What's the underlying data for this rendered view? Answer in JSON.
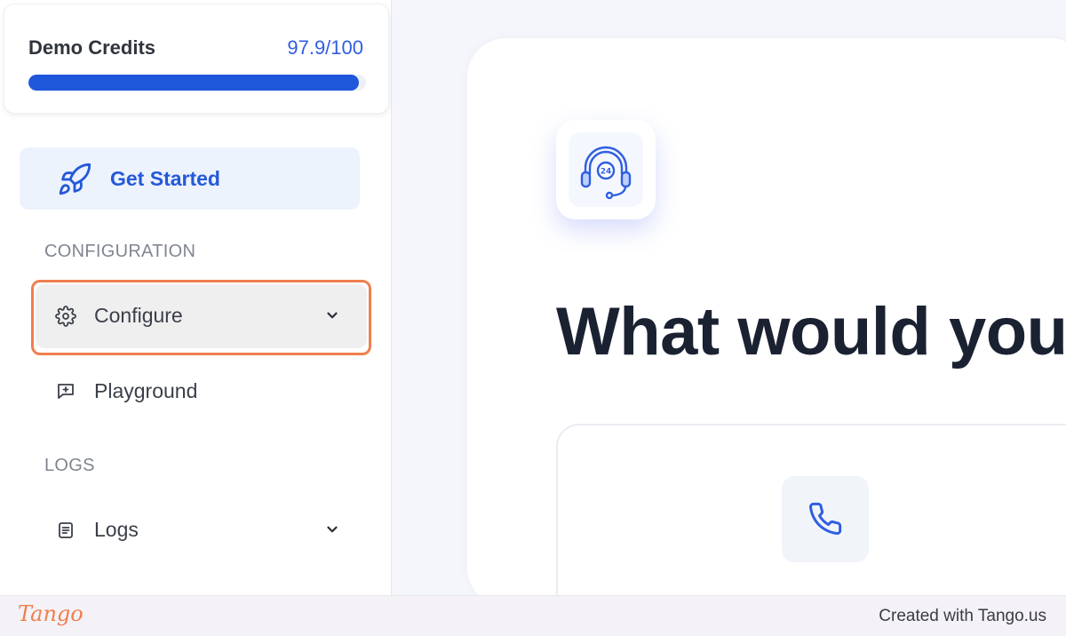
{
  "credits": {
    "label": "Demo Credits",
    "value": "97.9/100",
    "progress_fraction": 0.979,
    "bar_color": "#1f57db"
  },
  "nav": {
    "get_started": {
      "label": "Get Started",
      "icon": "rocket-icon"
    },
    "configuration_header": "CONFIGURATION",
    "configure": {
      "label": "Configure",
      "icon": "gear-icon",
      "state": "highlighted"
    },
    "playground": {
      "label": "Playground",
      "icon": "message-plus-icon"
    },
    "logs_header": "LOGS",
    "logs": {
      "label": "Logs",
      "icon": "document-list-icon"
    }
  },
  "main": {
    "headline": "What would you",
    "hero_icon": "headset-24-support-icon",
    "option_icon": "phone-icon"
  },
  "footer": {
    "logo": "Tango",
    "credit": "Created with Tango.us"
  },
  "colors": {
    "accent": "#2559d8",
    "highlight_border": "#ef7f4f"
  }
}
